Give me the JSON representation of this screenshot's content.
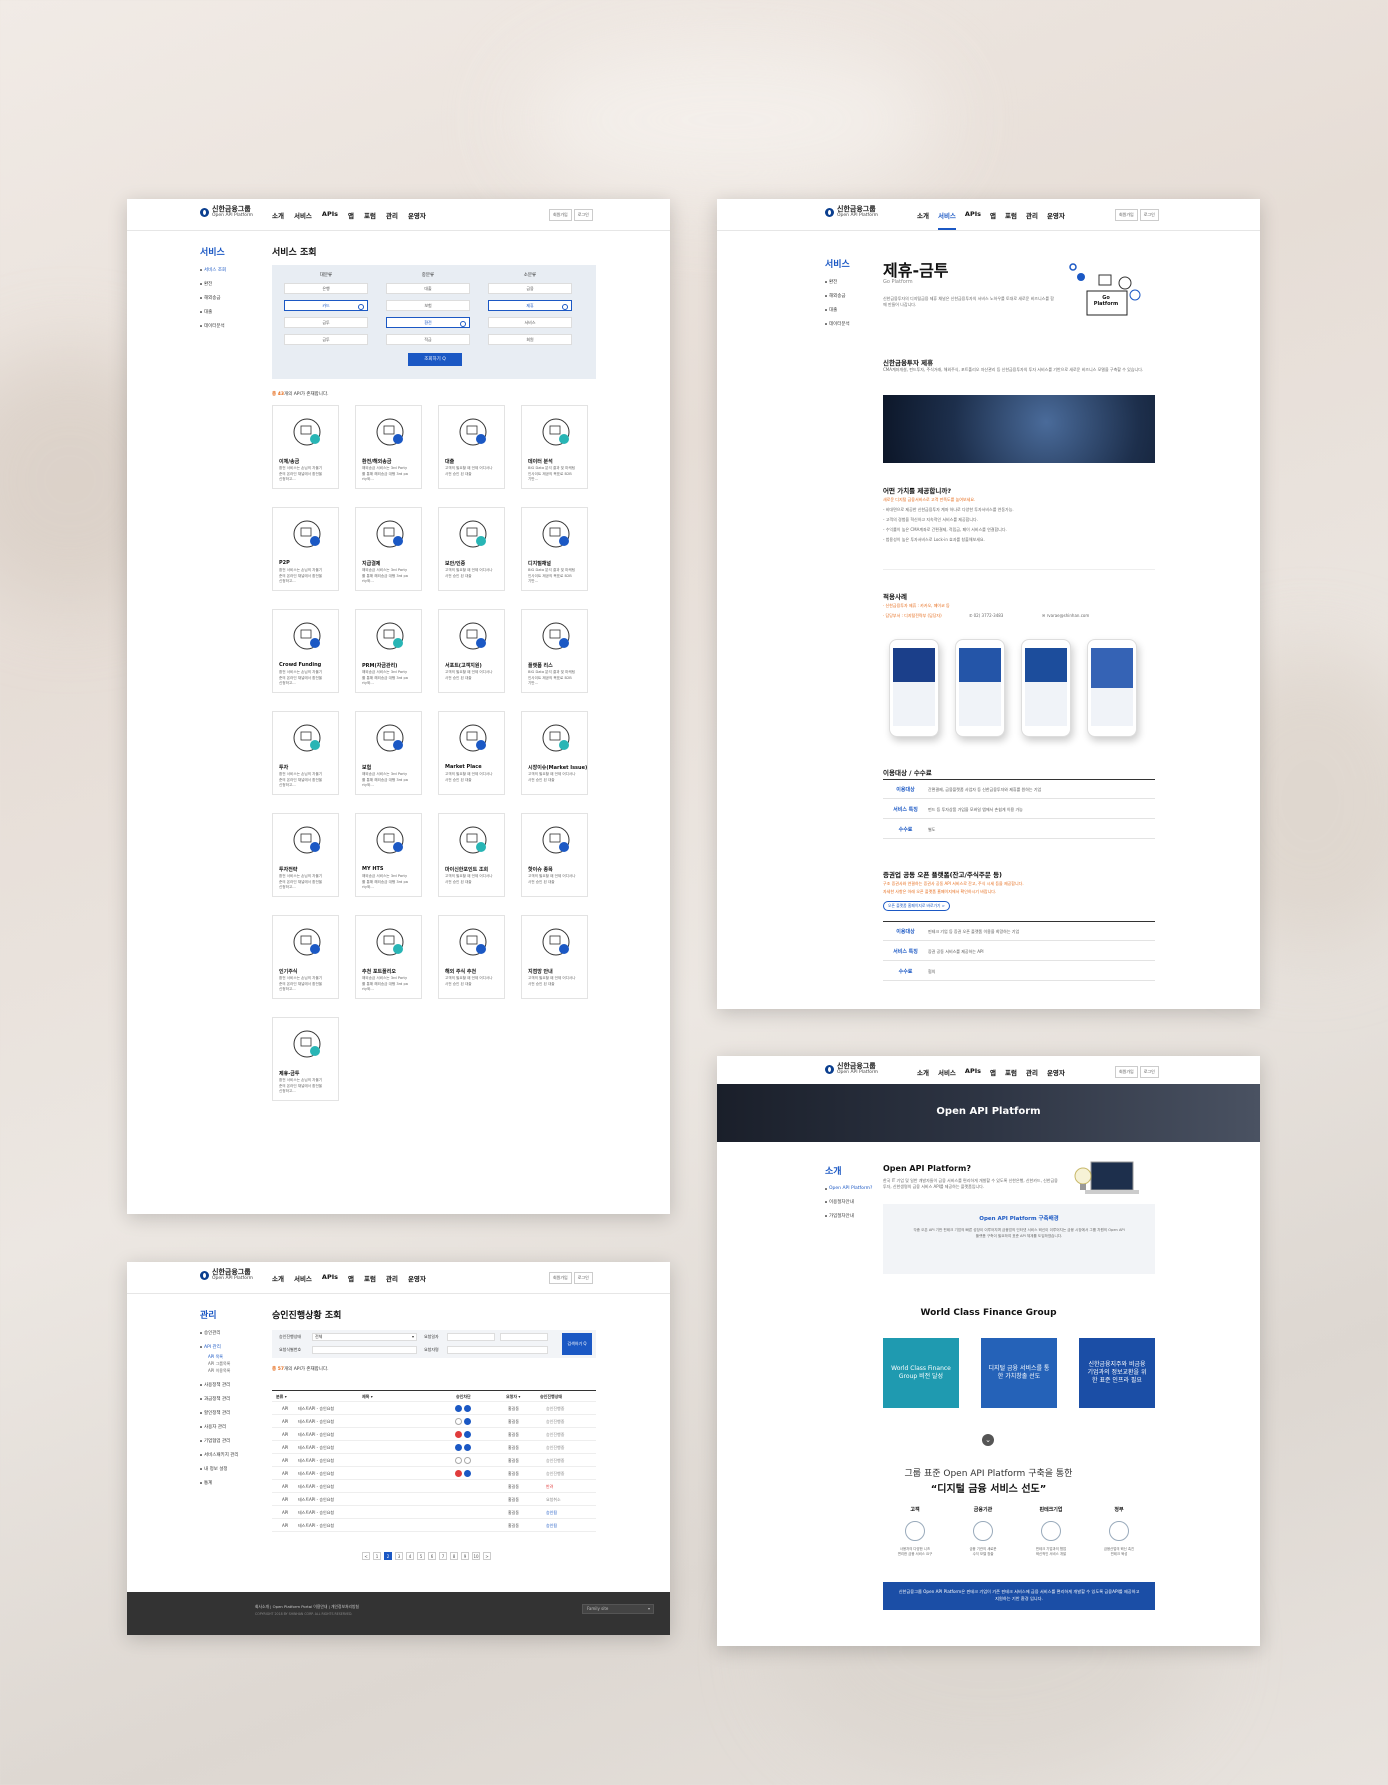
{
  "brand": {
    "name": "신한금융그룹",
    "sub": "Open API Platform"
  },
  "nav": [
    "소개",
    "서비스",
    "APIs",
    "앱",
    "포럼",
    "관리",
    "운영자"
  ],
  "hbtns": [
    "회원가입",
    "로그인"
  ],
  "p1": {
    "side_title": "서비스",
    "side_items": [
      "서비스 조회",
      "환전",
      "해외송금",
      "대출",
      "데이터분석"
    ],
    "title": "서비스 조회",
    "filter_heads": [
      "대분류",
      "중분류",
      "소분류"
    ],
    "filter_cols": [
      [
        "은행",
        "카드",
        "금투",
        "금투"
      ],
      [
        "대출",
        "보험",
        "환전",
        "적금"
      ],
      [
        "금융",
        "제휴",
        "서비스",
        "회원"
      ]
    ],
    "search_btn": "조회하기 Q",
    "count_pre": "총 ",
    "count_num": "43",
    "count_post": "개의 API가 존재합니다.",
    "cards": [
      {
        "t": "이체/송금",
        "d": "환전 서비스는 손님의 자율기\n준의 온라인 채널에서 환전을\n신청하고..."
      },
      {
        "t": "환전/해외송금",
        "d": "해외송금 서비스는 3rd Party\n를 통해 해외송금 대행 3rd pa\nrty와..."
      },
      {
        "t": "대출",
        "d": "고객의 필요할 때 언제 어디서나\n 사전 승인 된 대출"
      },
      {
        "t": "데이터 분석",
        "d": "BIG Data 분석 결과 및 마케팅\n인사이트 제공의 목표로 B2B\n기반..."
      },
      {
        "t": "P2P",
        "d": "환전 서비스는 손님의 자율기\n준의 온라인 채널에서 환전을\n신청하고..."
      },
      {
        "t": "지급결제",
        "d": "해외송금 서비스는 3rd Party\n를 통해 해외송금 대행 3rd pa\nrty와..."
      },
      {
        "t": "보안/인증",
        "d": "고객의 필요할 때 언제 어디서나\n 사전 승인 된 대출"
      },
      {
        "t": "디지털채널",
        "d": "BIG Data 분석 결과 및 마케팅\n인사이트 제공의 목표로 B2B\n기반..."
      },
      {
        "t": "Crowd Funding",
        "d": "환전 서비스는 손님의 자율기\n준의 온라인 채널에서 환전을\n신청하고..."
      },
      {
        "t": "PRM(자금관리)",
        "d": "해외송금 서비스는 3rd Party\n를 통해 해외송금 대행 3rd pa\nrty와..."
      },
      {
        "t": "서포트(고객지원)",
        "d": "고객의 필요할 때 언제 어디서나\n 사전 승인 된 대출"
      },
      {
        "t": "플랫폼 리스",
        "d": "BIG Data 분석 결과 및 마케팅\n인사이트 제공의 목표로 B2B\n기반..."
      },
      {
        "t": "투자",
        "d": "환전 서비스는 손님의 자율기\n준의 온라인 채널에서 환전을\n신청하고..."
      },
      {
        "t": "보험",
        "d": "해외송금 서비스는 3rd Party\n를 통해 해외송금 대행 3rd pa\nrty와..."
      },
      {
        "t": "Market Place",
        "d": "고객의 필요할 때 언제 어디서나\n 사전 승인 된 대출"
      },
      {
        "t": "시장이슈(Market Issue)",
        "d": "고객의 필요할 때 언제 어디서나\n 사전 승인 된 대출"
      },
      {
        "t": "투자전략",
        "d": "환전 서비스는 손님의 자율기\n준의 온라인 채널에서 환전을\n신청하고..."
      },
      {
        "t": "MY HTS",
        "d": "해외송금 서비스는 3rd Party\n를 통해 해외송금 대행 3rd pa\nrty와..."
      },
      {
        "t": "마이신한포인트 조회",
        "d": "고객의 필요할 때 언제 어디서나\n 사전 승인 된 대출"
      },
      {
        "t": "핫이슈 종목",
        "d": "고객의 필요할 때 언제 어디서나\n 사전 승인 된 대출"
      },
      {
        "t": "인기주식",
        "d": "환전 서비스는 손님의 자율기\n준의 온라인 채널에서 환전을\n신청하고..."
      },
      {
        "t": "추천 포트폴리오",
        "d": "해외송금 서비스는 3rd Party\n를 통해 해외송금 대행 3rd pa\nrty와..."
      },
      {
        "t": "해외 주식 추천",
        "d": "고객의 필요할 때 언제 어디서나\n 사전 승인 된 대출"
      },
      {
        "t": "지점망 안내",
        "d": "고객의 필요할 때 언제 어디서나\n 사전 승인 된 대출"
      },
      {
        "t": "제휴-금투",
        "d": "환전 서비스는 손님의 자율기\n준의 온라인 채널에서 환전을\n신청하고..."
      }
    ]
  },
  "p2": {
    "side_title": "서비스",
    "side_items": [
      "환전",
      "해외송금",
      "대출",
      "데이터분석"
    ],
    "title": "제휴-금투",
    "subtitle": "Go Platform",
    "intro": "신한금융투자의 디지털금융 제휴 채널은 신한금융투자의 서비스 노하우를 토대로 새로운 비즈니스를 함께 만들어 나갑니다.",
    "badge": "Go Platform",
    "s1_title": "신한금융투자 제휴",
    "s1_desc": "CMA계좌개설, 펀드투자, 주식거래, 해외주식, 포트폴리오 자산관리 등 신한금융투자의 투자 서비스를 기반으로 새로운 비즈니스 모델을 구축할 수 있습니다.",
    "s2_title": "어떤 가치를 제공합니까?",
    "s2_lead": "새로운 디지털 금융서비스로 고객 만족도를 높여보세요.",
    "s2_points": [
      "- 비대면으로 제공한 신한금융투자 계좌 하나로 다양한 투자서비스를 연동가능.",
      "- 고객의 경험을 혁신하고 지속적인 서비스를 제공합니다.",
      "- 수익률이 높은 CMA계좌로 간편결제, 적립금, 페이 서비스를 연결합니다.",
      "- 범용성이 높은 투자서비스로 Lock-in 효과를 창출해보세요."
    ],
    "s3_title": "적용사례",
    "s3_lines": [
      "· 신한금융투자 제휴 : 카카오, 페이코 등",
      "· 담당부서 : 디지털전략부 (담당자)"
    ],
    "s3_phone": "02) 3772-3483",
    "s3_mail": "rvarae@shinhan.com",
    "s4_title": "이용대상 / 수수료",
    "rows1": [
      {
        "k": "이용대상",
        "v": "간편결제, 금융플랫폼 사업자 등 신한금융투자와 제휴를 원하는 기업"
      },
      {
        "k": "서비스 특징",
        "v": "펀드 등 투자상품 가입을 모바일 앱에서 손쉽게 이용 가능"
      },
      {
        "k": "수수료",
        "v": "별도"
      }
    ],
    "s5_title": "증권업 공동 오픈 플랫폼(잔고/주식주문 등)",
    "s5_lead": "구조 증권사와 연결하는 증권사 공동 API 서비스로 잔고, 주식 시세 등을 제공합니다.",
    "s5_sub": "자세한 사항은 아래 오픈 플랫폼 홈페이지에서 확인하시기 바랍니다.",
    "s5_link": "오픈 플랫폼 홈페이지로 바로가기 >",
    "rows2": [
      {
        "k": "이용대상",
        "v": "핀테크 기업 등 증권 오픈 플랫폼 이용을 희망하는 기업"
      },
      {
        "k": "서비스 특징",
        "v": "증권 공동 서비스를 제공하는 API"
      },
      {
        "k": "수수료",
        "v": "협의"
      }
    ]
  },
  "p3": {
    "side_title": "관리",
    "side_items": [
      "승인관리",
      "API 관리",
      "사용정책 관리",
      "과금정책 관리",
      "할인정책 관리",
      "사용자 관리",
      "기업협업 관리",
      "서비스패키지 관리",
      "내 정보 설정",
      "통계"
    ],
    "side_subs": [
      "API 목록",
      "API 그룹목록",
      "API 이용목록"
    ],
    "title": "승인진행상황 조회",
    "lbl_state": "승인진행상태",
    "sel_all": "전체",
    "lbl_date": "요청일자",
    "lbl_req": "요청자명",
    "lbl_no": "요청식별번호",
    "search_btn": "검색하기 Q",
    "count_pre": "총 ",
    "count_num": "57",
    "count_post": "개의 API가 존재합니다.",
    "cols": [
      "분류 ▾",
      "제목 ▾",
      "승인차단",
      "요청자 ▾",
      "승인진행상태"
    ],
    "rows": [
      {
        "c": "API",
        "t": "테스트API - 승인요청",
        "d": [
          "b",
          "b"
        ],
        "u": "홍길동",
        "s": "승인진행중"
      },
      {
        "c": "API",
        "t": "테스트API - 승인요청",
        "d": [
          "",
          "b"
        ],
        "u": "홍길동",
        "s": "승인진행중"
      },
      {
        "c": "API",
        "t": "테스트API - 승인요청",
        "d": [
          "r",
          "b"
        ],
        "u": "홍길동",
        "s": "승인진행중"
      },
      {
        "c": "API",
        "t": "테스트API - 승인요청",
        "d": [
          "b",
          "b"
        ],
        "u": "홍길동",
        "s": "승인진행중"
      },
      {
        "c": "API",
        "t": "테스트API - 승인요청",
        "d": [
          "",
          ""
        ],
        "u": "홍길동",
        "s": "승인진행중"
      },
      {
        "c": "API",
        "t": "테스트API - 승인요청",
        "d": [
          "r",
          "b"
        ],
        "u": "홍길동",
        "s": "승인진행중"
      },
      {
        "c": "API",
        "t": "테스트API - 승인요청",
        "d": [],
        "u": "홍길동",
        "s": "반려"
      },
      {
        "c": "API",
        "t": "테스트API - 승인요청",
        "d": [],
        "u": "홍길동",
        "s": "요청취소"
      },
      {
        "c": "API",
        "t": "테스트API - 승인요청",
        "d": [],
        "u": "홍길동",
        "s": "승인됨"
      },
      {
        "c": "API",
        "t": "테스트API - 승인요청",
        "d": [],
        "u": "홍길동",
        "s": "승인됨"
      }
    ],
    "pages": [
      "<",
      "1",
      "2",
      "3",
      "4",
      "5",
      "6",
      "7",
      "8",
      "9",
      "10",
      ">"
    ],
    "footer_links": "회사소개  |  Open Platform Portal 이용안내  |  개인정보처리방침",
    "copyright": "COPYRIGHT 2018 BY SHINHAN CORP. ALL RIGHTS RESERVED.",
    "family": "Family site"
  },
  "p4": {
    "banner": "Open API Platform",
    "side_title": "소개",
    "side_items": [
      "Open API Platform?",
      "이용절차안내",
      "가입절차안내"
    ],
    "h": "Open API Platform?",
    "desc": "한국 IT 기업 및 일반 개발자들이 금융 서비스를 편리하게 개발할 수 있도록 신한은행, 신한카드, 신한금융투자, 신한생명의 금융 서비스 API를 제공하는 플랫폼입니다.",
    "box_h": "Open API Platform 구축배경",
    "box_d": "각종 오픈 API 기반 핀테크 기업의 빠른 성장이 이루어지며 금융업의 인터넷 서비스 혁신이 이루어지는 금융 시장에서 그룹 차원의 Open API 플랫폼 구축이 필요하여 표준 API 체계를 도입하였습니다.",
    "wcfg": "World Class Finance Group",
    "boxes": [
      "World Class Finance Group 비전 달성",
      "디지털 금융 서비스를 통한 가치창출 선도",
      "신한금융지주와 비금융 기업과의 정보교환을 위한 표준 인프라 필요"
    ],
    "tag1": "그룹 표준 Open API Platform 구축을 통한",
    "tag2": "“디지털 금융 서비스 선도”",
    "cols": [
      {
        "h": "고객",
        "d": "사용자의 다양한 니즈\n편리한 금융 서비스 요구"
      },
      {
        "h": "금융기관",
        "d": "금융 기관의 새로운\n수익 모델 창출"
      },
      {
        "h": "핀테크기업",
        "d": "핀테크 기업과의 협업\n혁신적인 서비스 개발"
      },
      {
        "h": "정부",
        "d": "금융산업의 혁신 촉진\n핀테크 육성"
      }
    ],
    "bar": "신한금융그룹 Open API Platform은 핀테크 기업이 기존 핀테크 서비스에 금융 서비스를 편리하게 개발할 수 있도록 금융API를 제공하고 지원하는 기반 환경 입니다."
  },
  "colors": {
    "primary": "#1b58c4",
    "orange": "#e66c1c",
    "teal": "#1f9ab0",
    "navy": "#1b3f8a"
  }
}
